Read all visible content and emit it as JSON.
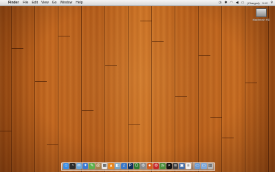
{
  "menubar": {
    "apple_icon": "apple-logo-icon",
    "app_name": "Finder",
    "items": [
      "File",
      "Edit",
      "View",
      "Go",
      "Window",
      "Help"
    ],
    "status": {
      "battery": "(Charged)",
      "clock": "5:12"
    }
  },
  "desktop": {
    "icons": [
      {
        "label": "Macintosh HD"
      }
    ]
  },
  "dock": {
    "apps": [
      {
        "name": "finder-icon",
        "color": "#3a8ee6",
        "glyph": "☺"
      },
      {
        "name": "dashboard-icon",
        "color": "#2b2b2b",
        "glyph": "◔"
      },
      {
        "name": "mail-icon",
        "color": "#6aa6d8",
        "glyph": "✉"
      },
      {
        "name": "safari-icon",
        "color": "#3b7bd4",
        "glyph": "✦"
      },
      {
        "name": "ichat-icon",
        "color": "#5fb04c",
        "glyph": "✎"
      },
      {
        "name": "address-book-icon",
        "color": "#a8824a",
        "glyph": "@"
      },
      {
        "name": "ical-icon",
        "color": "#e8e8e8",
        "glyph": "▦"
      },
      {
        "name": "vlc-icon",
        "color": "#e8871e",
        "glyph": "▲"
      },
      {
        "name": "preview-icon",
        "color": "#7aa7c7",
        "glyph": "◧"
      },
      {
        "name": "itunes-icon",
        "color": "#3c79c9",
        "glyph": "♫"
      },
      {
        "name": "photoshop-icon",
        "color": "#0d2e5a",
        "glyph": "P"
      },
      {
        "name": "dreamweaver-icon",
        "color": "#2e7d32",
        "glyph": "D"
      },
      {
        "name": "system-preferences-icon",
        "color": "#8a8a8a",
        "glyph": "⚙"
      },
      {
        "name": "firefox-icon",
        "color": "#d35d1c",
        "glyph": "●"
      },
      {
        "name": "transmission-icon",
        "color": "#c62828",
        "glyph": "⚙"
      },
      {
        "name": "time-machine-icon",
        "color": "#4a8c3a",
        "glyph": "◷"
      },
      {
        "name": "terminal-icon",
        "color": "#111111",
        "glyph": ">"
      },
      {
        "name": "activity-monitor-icon",
        "color": "#3e3e3e",
        "glyph": "≋"
      },
      {
        "name": "spaces-icon",
        "color": "#4a6fa5",
        "glyph": "▣"
      },
      {
        "name": "textedit-icon",
        "color": "#f2f2f2",
        "glyph": "≡"
      }
    ],
    "stack_items": [
      {
        "name": "applications-folder-icon",
        "color": "#6d9ad0",
        "glyph": "▭"
      },
      {
        "name": "documents-folder-icon",
        "color": "#7fa8d8",
        "glyph": "▭"
      },
      {
        "name": "trash-icon",
        "color": "#b8b8b8",
        "glyph": "▥"
      }
    ]
  }
}
